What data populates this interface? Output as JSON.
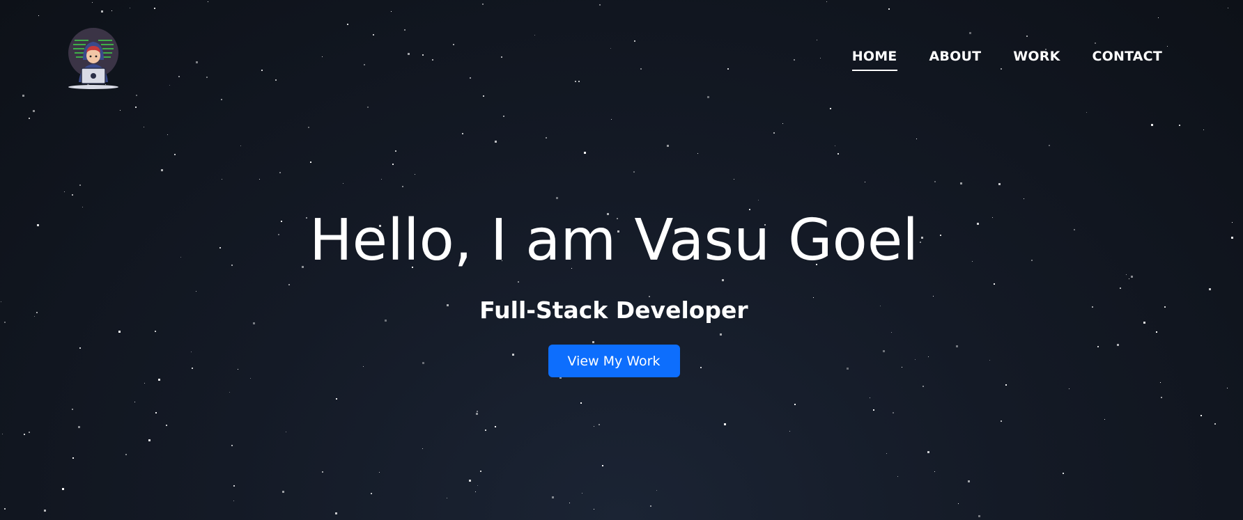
{
  "logo": {
    "icon": "developer-avatar-icon"
  },
  "nav": {
    "items": [
      {
        "label": "HOME",
        "active": true
      },
      {
        "label": "ABOUT",
        "active": false
      },
      {
        "label": "WORK",
        "active": false
      },
      {
        "label": "CONTACT",
        "active": false
      }
    ]
  },
  "hero": {
    "title": "Hello, I am Vasu Goel",
    "subtitle": "Full-Stack Developer",
    "cta_label": "View My Work"
  },
  "colors": {
    "accent": "#0d6efd",
    "background": "#141a26",
    "text": "#ffffff"
  }
}
